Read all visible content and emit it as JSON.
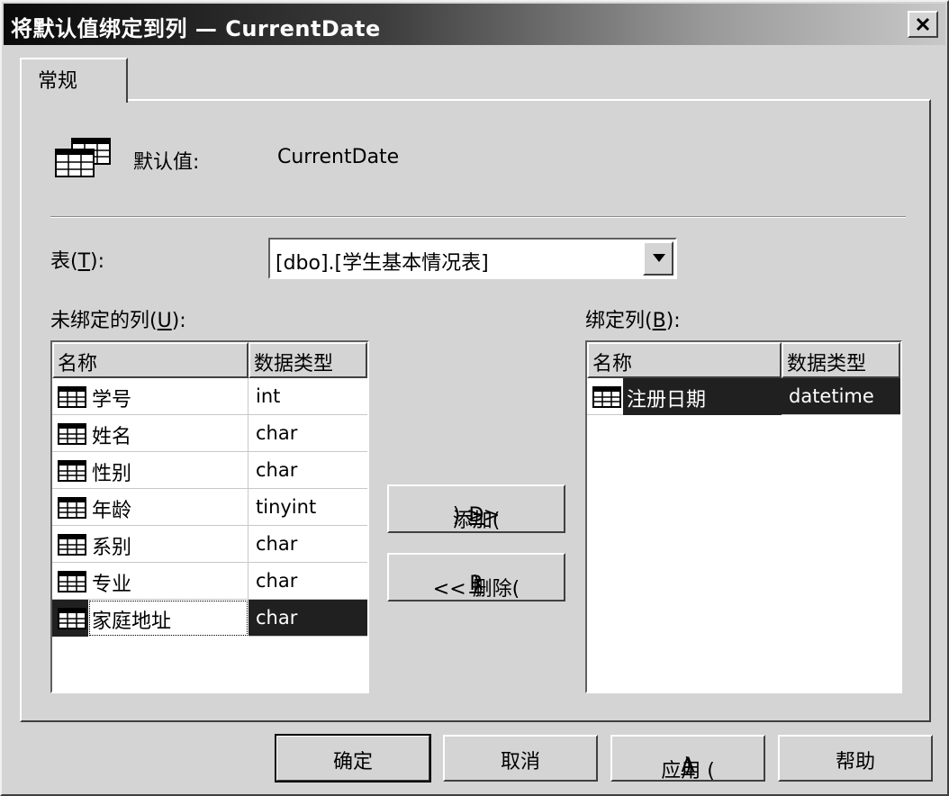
{
  "window": {
    "title": "将默认值绑定到列 — CurrentDate",
    "close_label": "✕"
  },
  "tabs": [
    {
      "label": "常规"
    }
  ],
  "default_value": {
    "label": "默认值:",
    "value": "CurrentDate",
    "icon": "table-icon"
  },
  "table_select": {
    "label_prefix": "表(",
    "label_key": "T",
    "label_suffix": "):",
    "value": "[dbo].[学生基本情况表]"
  },
  "unbound": {
    "label_prefix": "未绑定的列(",
    "label_key": "U",
    "label_suffix": "):",
    "headers": [
      "名称",
      "数据类型"
    ],
    "rows": [
      {
        "name": "学号",
        "type": "int"
      },
      {
        "name": "姓名",
        "type": "char"
      },
      {
        "name": "性别",
        "type": "char"
      },
      {
        "name": "年龄",
        "type": "tinyint"
      },
      {
        "name": "系别",
        "type": "char"
      },
      {
        "name": "专业",
        "type": "char"
      },
      {
        "name": "家庭地址",
        "type": "char"
      }
    ],
    "selected_index": 6
  },
  "bound": {
    "label_prefix": "绑定列(",
    "label_key": "B",
    "label_suffix": "):",
    "headers": [
      "名称",
      "数据类型"
    ],
    "rows": [
      {
        "name": "注册日期",
        "type": "datetime"
      }
    ],
    "selected_index": 0
  },
  "actions": {
    "add": {
      "prefix": "添加(",
      "key": "D",
      "suffix": ") >>"
    },
    "remove": {
      "prefix": "<< 删除(",
      "key": "R",
      "suffix": ")"
    }
  },
  "footer": {
    "ok": "确定",
    "cancel": "取消",
    "apply_prefix": "应用 (",
    "apply_key": "A",
    "apply_suffix": ")",
    "help": "帮助"
  }
}
